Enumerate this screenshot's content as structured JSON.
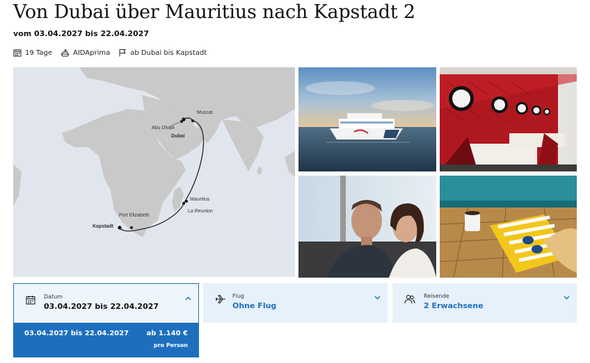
{
  "header": {
    "title": "Von Dubai über Mauritius nach Kapstadt 2",
    "dates": "vom 03.04.2027 bis 22.04.2027"
  },
  "facts": {
    "duration": "19 Tage",
    "ship": "AIDAprima",
    "route": "ab Dubai bis Kapstadt"
  },
  "map": {
    "ports": {
      "muscat": "Muscat",
      "abu_dhabi": "Abu Dhabi",
      "dubai": "Dubai",
      "mauritius": "Mauritius",
      "la_reunion": "La Reunion",
      "port_elizabeth": "Port Elizabeth",
      "kapstadt": "Kapstadt"
    }
  },
  "booking": {
    "date": {
      "label": "Datum",
      "value": "03.04.2027 bis 22.04.2027"
    },
    "flight": {
      "label": "Flug",
      "value": "Ohne Flug"
    },
    "travellers": {
      "label": "Reisende",
      "value": "2 Erwachsene"
    },
    "option": {
      "range": "03.04.2027 bis 22.04.2027",
      "price": "ab 1.140 €",
      "per": "pro Person"
    }
  },
  "colors": {
    "accent": "#1d6fbd",
    "selector_bg": "#e6f1fb",
    "map_water": "#e1e6ee",
    "map_land": "#c9c9c9"
  }
}
